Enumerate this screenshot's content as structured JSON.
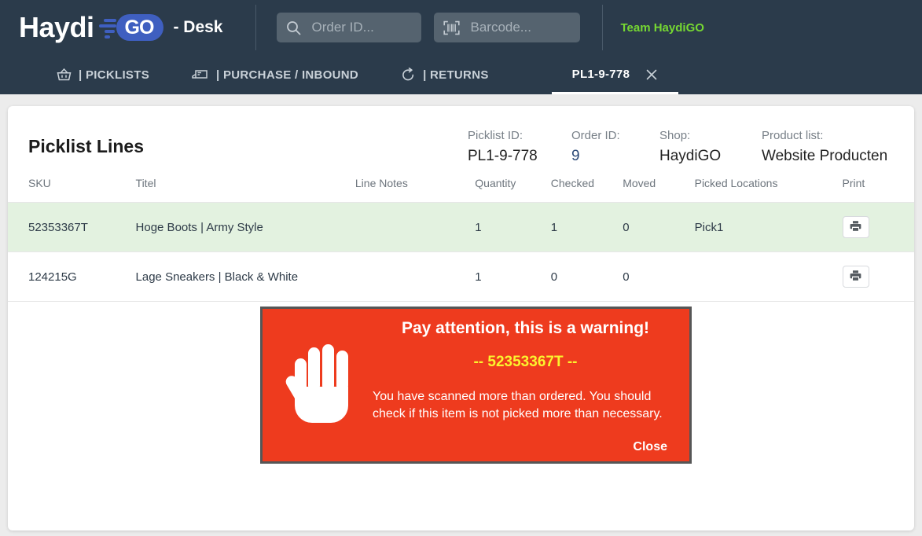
{
  "header": {
    "logo_main": "Haydi",
    "logo_badge": "GO",
    "logo_suffix": "- Desk",
    "order_search": {
      "placeholder": "Order ID...",
      "value": "",
      "icon": "search-icon"
    },
    "barcode_search": {
      "placeholder": "Barcode...",
      "value": "",
      "icon": "barcode-icon"
    },
    "team_label": "Team HaydiGO",
    "team_color": "#76d832"
  },
  "nav": {
    "items": [
      {
        "label": "| PICKLISTS",
        "icon": "basket-icon"
      },
      {
        "label": "| PURCHASE / INBOUND",
        "icon": "truck-icon"
      },
      {
        "label": "| RETURNS",
        "icon": "return-arrow-icon"
      }
    ],
    "active_tab": {
      "label": "PL1-9-778",
      "close_icon": "close-icon"
    }
  },
  "card": {
    "title": "Picklist Lines",
    "meta": [
      {
        "label": "Picklist ID:",
        "value": "PL1-9-778"
      },
      {
        "label": "Order ID:",
        "value": "9"
      },
      {
        "label": "Shop:",
        "value": "HaydiGO"
      },
      {
        "label": "Product list:",
        "value": "Website Producten"
      }
    ],
    "table": {
      "columns": [
        "SKU",
        "Titel",
        "Line Notes",
        "Quantity",
        "Checked",
        "Moved",
        "Picked Locations",
        "Print"
      ],
      "rows": [
        {
          "sku": "52353367T",
          "titel": "Hoge Boots | Army Style",
          "line_notes": "",
          "quantity": "1",
          "checked": "1",
          "moved": "0",
          "picked_locations": "Pick1",
          "print_icon": "printer-icon",
          "highlighted": true
        },
        {
          "sku": "124215G",
          "titel": "Lage Sneakers | Black & White",
          "line_notes": "",
          "quantity": "1",
          "checked": "0",
          "moved": "0",
          "picked_locations": "",
          "print_icon": "printer-icon",
          "highlighted": false
        }
      ]
    }
  },
  "modal": {
    "icon": "stop-hand-icon",
    "title": "Pay attention, this is a warning!",
    "sku_line": "-- 52353367T --",
    "message": "You have scanned more than ordered. You should check if this item is not picked more than necessary.",
    "close_label": "Close",
    "background": "#ee3b1e",
    "sku_color": "#fbf32e",
    "border_color": "#565656"
  }
}
